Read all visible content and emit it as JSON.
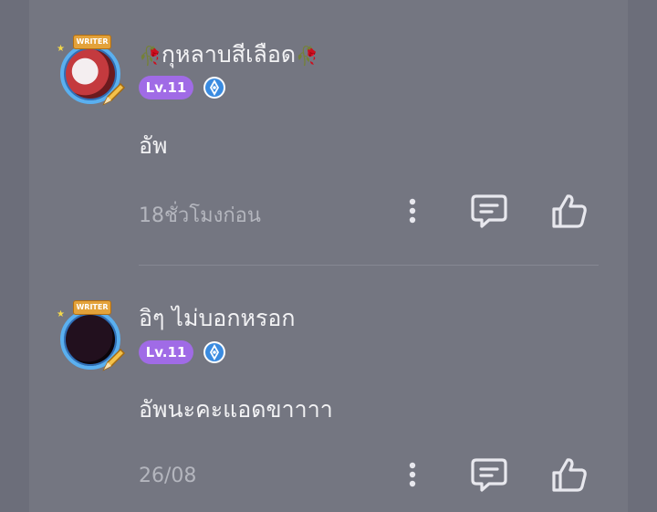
{
  "comments": [
    {
      "username": "กุหลาบสีเลือด",
      "level": "Lv.11",
      "badge": "WRITER",
      "text": "อัพ",
      "time": "18ชั่วโมงก่อน",
      "avatar_color": "#b3262c"
    },
    {
      "username": "อิๆ ไม่บอกหรอก",
      "level": "Lv.11",
      "badge": "WRITER",
      "text": "อัพนะคะแอดขาาาา",
      "time": "26/08",
      "avatar_color": "#160a14"
    }
  ],
  "icons": {
    "rose": "🥀",
    "more": "more-vertical-icon",
    "reply": "comment-icon",
    "like": "thumbs-up-icon"
  },
  "colors": {
    "background": "#747681",
    "level_badge": "#a06be6",
    "verified": "#3a8be0",
    "text": "#f2f2f4",
    "muted": "#b4b6be"
  }
}
